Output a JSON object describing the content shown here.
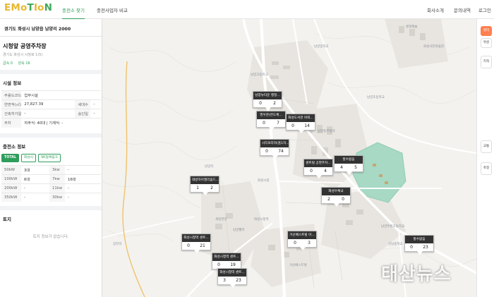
{
  "header": {
    "logo_parts": [
      "EMo",
      "T",
      "Io",
      "N"
    ],
    "nav": [
      "충전소 찾기",
      "충전사업자 비교"
    ],
    "right_links": [
      "회사소개",
      "문의내역",
      "로그인"
    ]
  },
  "panel": {
    "address": "경기도 화성시 남양읍 남양리 2000",
    "station_name": "시청앞 공영주차장",
    "sub_address": "경기도 화성시 시청로 1(5)",
    "tags": [
      "급속 0",
      "완속 16"
    ],
    "facility": {
      "title": "시설 정보",
      "rows": [
        {
          "h1": "주용도코드",
          "v1": "업무시설",
          "h2": "",
          "v2": ""
        },
        {
          "h1": "연면적(㎡)",
          "v1": "27,827.39",
          "h2": "세대수",
          "v2": "-"
        },
        {
          "h1": "건축허가일",
          "v1": "-",
          "h2": "승인일",
          "v2": "-"
        },
        {
          "h1": "주차",
          "v1": "자주식: 40대 | 기계식: -",
          "h2": "",
          "v2": ""
        }
      ]
    },
    "charger": {
      "title": "충전소 정보",
      "chips": [
        "TOTAL",
        "화성시",
        "SK일렉링크"
      ],
      "rows": [
        {
          "k1": "50kW",
          "v1": "3대",
          "k2": "3kw",
          "v2": "-"
        },
        {
          "k1": "100kW",
          "v1": "6대",
          "k2": "7kw",
          "v2": "16대"
        },
        {
          "k1": "200kW",
          "v1": "-",
          "k2": "11kw",
          "v2": "-"
        },
        {
          "k1": "350kW",
          "v1": "-",
          "k2": "30kw",
          "v2": "-"
        }
      ]
    },
    "land": {
      "title": "토지",
      "empty": "토지 정보가 없습니다."
    }
  },
  "map": {
    "markers": [
      {
        "name": "남양뉴타운 행정...",
        "a": "0",
        "b": "2"
      },
      {
        "name": "영우관(반도체...",
        "a": "0",
        "b": "7"
      },
      {
        "name": "화성도서관 야외...",
        "a": "0",
        "b": "14"
      },
      {
        "name": "시티프라자(홈1차...",
        "a": "0",
        "b": "74"
      },
      {
        "name": "센트럴 공영주차...",
        "a": "0",
        "b": "4"
      },
      {
        "name": "할수없음",
        "a": "4",
        "b": "5"
      },
      {
        "name": "대방하이엘리움드...",
        "a": "1",
        "b": "2"
      },
      {
        "name": "화성우체국",
        "a": "2",
        "b": "0"
      },
      {
        "name": "거산베스트빌 아...",
        "a": "0",
        "b": "3"
      },
      {
        "name": "화성시청역 센트...",
        "a": "0",
        "b": "21"
      },
      {
        "name": "화성시청역 센트...",
        "a": "0",
        "b": "19"
      },
      {
        "name": "화성시청역 센트...",
        "a": "3",
        "b": "23"
      },
      {
        "name": "할수없음",
        "a": "0",
        "b": "23"
      }
    ],
    "place_labels": [
      "남양리",
      "남양고등학교",
      "남양초등학교",
      "남양중학교",
      "화성시청",
      "남양동부빌라",
      "남양주공1단지",
      "세일한양",
      "남양푸른초등학교",
      "화성시청역",
      "신남중학교",
      "장전리",
      "거산베스트빌",
      "롯데캐슬",
      "남양웰리",
      "화성사진박물관"
    ]
  },
  "right_strip": {
    "buttons": [
      "필터",
      "위성",
      "지적",
      "교통",
      "축정"
    ]
  },
  "watermark": "태산뉴스",
  "colors": {
    "brand_green": "#2e9e5b",
    "logo_yellow": "#e8b830",
    "park_green": "#a7d9c5",
    "active_orange": "#ff7f50"
  }
}
